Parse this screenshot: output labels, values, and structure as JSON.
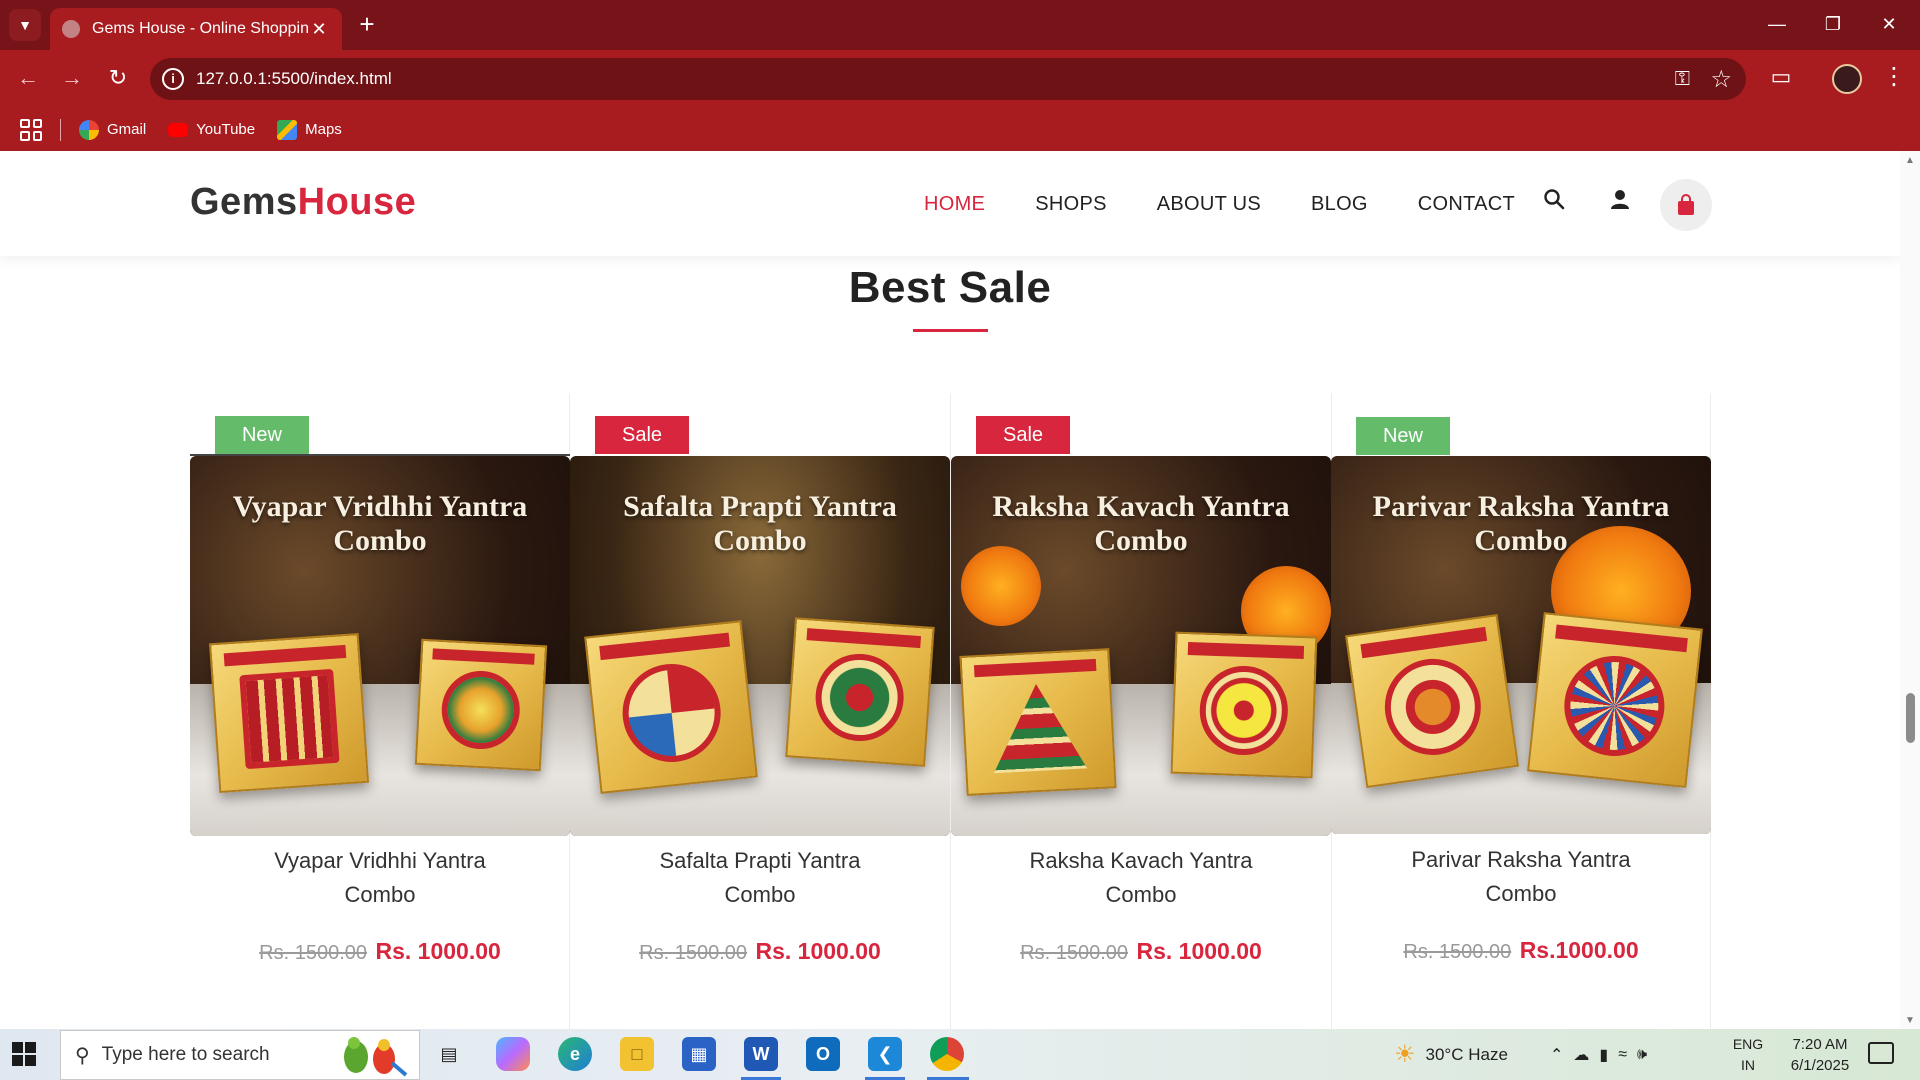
{
  "browser": {
    "tab_title": "Gems House - Online Shopping",
    "url": "127.0.0.1:5500/index.html",
    "bookmarks": [
      {
        "label": "Gmail",
        "icon": "google-icon"
      },
      {
        "label": "YouTube",
        "icon": "youtube-icon"
      },
      {
        "label": "Maps",
        "icon": "maps-icon"
      }
    ]
  },
  "site": {
    "logo_part1": "Gems",
    "logo_part2": "House",
    "nav": [
      "HOME",
      "SHOPS",
      "ABOUT US",
      "BLOG",
      "CONTACT"
    ],
    "active_nav": "HOME",
    "accent_color": "#d7263d"
  },
  "section": {
    "title": "Best Sale"
  },
  "products": [
    {
      "badge": "New",
      "badge_type": "new",
      "image_caption_line1": "Vyapar Vridhhi Yantra",
      "image_caption_line2": "Combo",
      "name_line1": "Vyapar Vridhhi Yantra",
      "name_line2": "Combo",
      "old_price": "Rs. 1500.00",
      "new_price": "Rs. 1000.00"
    },
    {
      "badge": "Sale",
      "badge_type": "sale",
      "image_caption_line1": "Safalta Prapti Yantra",
      "image_caption_line2": "Combo",
      "name_line1": "Safalta Prapti Yantra",
      "name_line2": "Combo",
      "old_price": "Rs. 1500.00",
      "new_price": "Rs. 1000.00"
    },
    {
      "badge": "Sale",
      "badge_type": "sale",
      "image_caption_line1": "Raksha Kavach Yantra",
      "image_caption_line2": "Combo",
      "name_line1": "Raksha Kavach Yantra",
      "name_line2": "Combo",
      "old_price": "Rs. 1500.00",
      "new_price": "Rs. 1000.00"
    },
    {
      "badge": "New",
      "badge_type": "new",
      "image_caption_line1": "Parivar Raksha Yantra",
      "image_caption_line2": "Combo",
      "name_line1": "Parivar Raksha Yantra",
      "name_line2": "Combo",
      "old_price": "Rs. 1500.00",
      "new_price": "Rs.1000.00"
    }
  ],
  "taskbar": {
    "search_placeholder": "Type here to search",
    "weather": "30°C  Haze",
    "lang_line1": "ENG",
    "lang_line2": "IN",
    "time": "7:20 AM",
    "date": "6/1/2025"
  }
}
